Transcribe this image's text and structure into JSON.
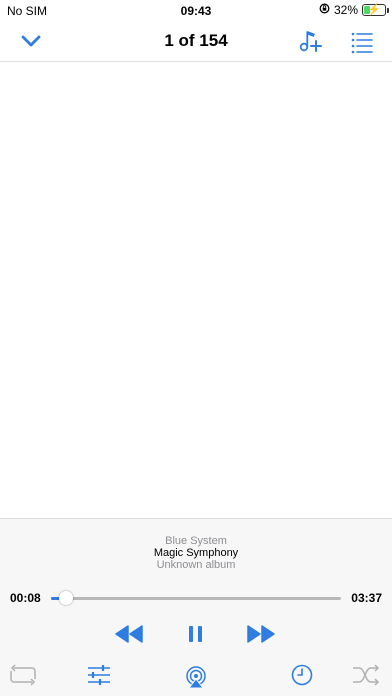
{
  "status": {
    "carrier": "No SIM",
    "time": "09:43",
    "battery": "32%",
    "battery_level": 0.32
  },
  "nav": {
    "title": "1 of 154",
    "icons": [
      "chevron-down-icon",
      "add-music-icon",
      "queue-list-icon"
    ]
  },
  "now_playing": {
    "artist": "Blue System",
    "track": "Magic Symphony",
    "album": "Unknown album"
  },
  "progress": {
    "elapsed": "00:08",
    "duration": "03:37",
    "fraction": 0.037
  },
  "controls": {
    "icons": [
      "rewind-icon",
      "pause-icon",
      "fast-forward-icon"
    ]
  },
  "toolbar": {
    "icons": [
      "repeat-icon",
      "equalizer-icon",
      "airplay-icon",
      "timer-icon",
      "shuffle-icon"
    ]
  },
  "colors": {
    "accent": "#2f7de1",
    "inactive": "#b0b0b0",
    "track_bg": "#b8b8b8"
  }
}
